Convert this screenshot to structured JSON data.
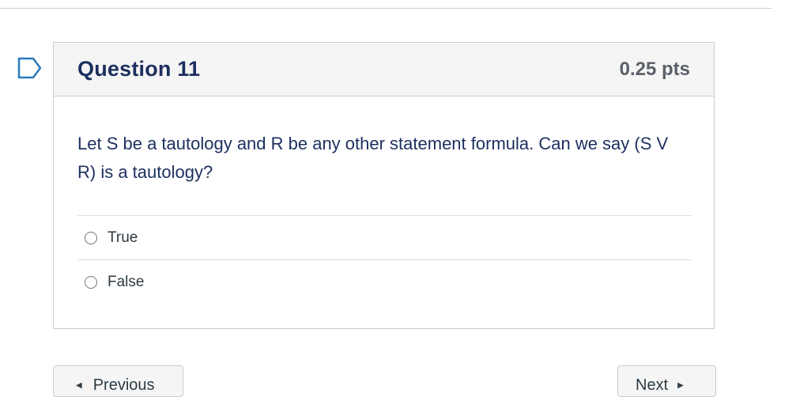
{
  "question": {
    "title": "Question 11",
    "points": "0.25 pts",
    "text": "Let S be a tautology and R be any other statement formula. Can we say (S V R) is a tautology?",
    "answers": [
      {
        "label": "True",
        "selected": false
      },
      {
        "label": "False",
        "selected": false
      }
    ]
  },
  "navigation": {
    "previous_label": "Previous",
    "next_label": "Next",
    "previous_icon": "left-triangle-icon",
    "next_icon": "right-triangle-icon"
  },
  "icons": {
    "flag": "bookmark-flag-icon"
  },
  "colors": {
    "title": "#1c2f5f",
    "points": "#5a6068",
    "header_bg": "#f5f5f5",
    "border": "#c7cdd1"
  }
}
